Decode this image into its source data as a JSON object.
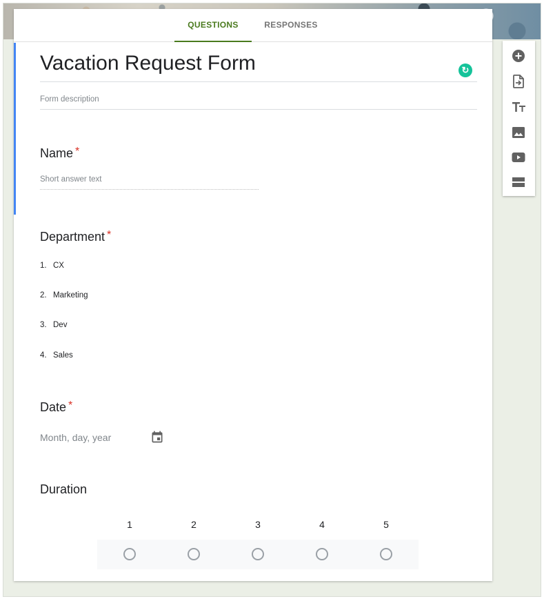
{
  "tabs": {
    "questions": "QUESTIONS",
    "responses": "RESPONSES"
  },
  "form": {
    "title": "Vacation Request Form",
    "description_placeholder": "Form description"
  },
  "questions": {
    "name": {
      "title": "Name",
      "required_mark": "*",
      "placeholder": "Short answer text"
    },
    "department": {
      "title": "Department",
      "required_mark": "*",
      "options": [
        {
          "num": "1.",
          "label": "CX"
        },
        {
          "num": "2.",
          "label": "Marketing"
        },
        {
          "num": "3.",
          "label": "Dev"
        },
        {
          "num": "4.",
          "label": "Sales"
        }
      ]
    },
    "date": {
      "title": "Date",
      "required_mark": "*",
      "placeholder": "Month, day, year"
    },
    "duration": {
      "title": "Duration",
      "scale": [
        "1",
        "2",
        "3",
        "4",
        "5"
      ]
    }
  },
  "toolbar": {
    "icons": [
      "add-question-icon",
      "import-questions-icon",
      "add-title-icon",
      "add-image-icon",
      "add-video-icon",
      "add-section-icon"
    ]
  },
  "colors": {
    "accent": "#4a7a1e",
    "active_bar": "#4285f4",
    "required": "#d93025",
    "grammarly": "#15c39a"
  }
}
